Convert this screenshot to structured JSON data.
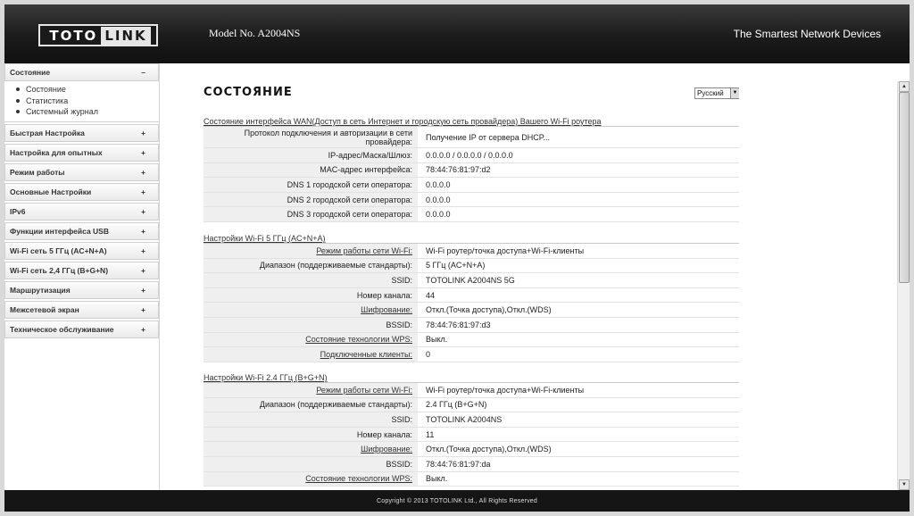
{
  "header": {
    "logo_left": "TOTO",
    "logo_right": "LINK",
    "model": "Model No. A2004NS",
    "tagline": "The Smartest Network Devices"
  },
  "sidebar": {
    "open_item": {
      "label": "Состояние",
      "toggle": "–"
    },
    "submenu": [
      "Состояние",
      "Статистика",
      "Системный журнал"
    ],
    "items": [
      {
        "label": "Быстрая Настройка",
        "toggle": "+"
      },
      {
        "label": "Настройка для опытных",
        "toggle": "+"
      },
      {
        "label": "Режим работы",
        "toggle": "+"
      },
      {
        "label": "Основные Настройки",
        "toggle": "+"
      },
      {
        "label": "IPv6",
        "toggle": "+"
      },
      {
        "label": "Функции интерфейса USB",
        "toggle": "+"
      },
      {
        "label": "Wi-Fi сеть 5 ГГц (AC+N+A)",
        "toggle": "+"
      },
      {
        "label": "Wi-Fi сеть 2,4 ГГц (B+G+N)",
        "toggle": "+"
      },
      {
        "label": "Маршрутизация",
        "toggle": "+"
      },
      {
        "label": "Межсетевой экран",
        "toggle": "+"
      },
      {
        "label": "Техническое обслуживание",
        "toggle": "+"
      }
    ]
  },
  "main": {
    "title": "СОСТОЯНИЕ",
    "language": "Русский",
    "wan": {
      "title": "Состояние интерфейса WAN(Доступ в сеть Интернет и городскую сеть провайдера) Вашего Wi-Fi роутера",
      "rows": [
        {
          "label": "Протокол подключения и авторизации в сети провайдера:",
          "value": "Получение IP от сервера DHCP..."
        },
        {
          "label": "IP-адрес/Маска/Шлюз:",
          "value": "0.0.0.0 / 0.0.0.0 / 0.0.0.0"
        },
        {
          "label": "MAC-адрес интерфейса:",
          "value": "78:44:76:81:97:d2"
        },
        {
          "label": "DNS 1 городской сети оператора:",
          "value": "0.0.0.0"
        },
        {
          "label": "DNS 2 городской сети оператора:",
          "value": "0.0.0.0"
        },
        {
          "label": "DNS 3 городской сети оператора:",
          "value": "0.0.0.0"
        }
      ]
    },
    "wifi5": {
      "title": "Настройки Wi-Fi 5 ГГц (AC+N+A)",
      "rows": [
        {
          "label": "Режим работы сети Wi-Fi:",
          "value": "Wi-Fi роутер/точка доступа+Wi-Fi-клиенты"
        },
        {
          "label": "Диапазон (поддерживаемые стандарты):",
          "value": "5 ГГц (AC+N+A)"
        },
        {
          "label": "SSID:",
          "value": "TOTOLINK A2004NS 5G"
        },
        {
          "label": "Номер канала:",
          "value": "44"
        },
        {
          "label": "Шифрование:",
          "value": "Откл.(Точка доступа),Откл.(WDS)"
        },
        {
          "label": "BSSID:",
          "value": "78:44:76:81:97:d3"
        },
        {
          "label": "Состояние технологии WPS:",
          "value": "Выкл."
        },
        {
          "label": "Подключенные клиенты:",
          "value": "0"
        }
      ]
    },
    "wifi24": {
      "title": "Настройки Wi-Fi 2.4 ГГц (B+G+N)",
      "rows": [
        {
          "label": "Режим работы сети Wi-Fi:",
          "value": "Wi-Fi роутер/точка доступа+Wi-Fi-клиенты"
        },
        {
          "label": "Диапазон (поддерживаемые стандарты):",
          "value": "2.4 ГГц (B+G+N)"
        },
        {
          "label": "SSID:",
          "value": "TOTOLINK A2004NS"
        },
        {
          "label": "Номер канала:",
          "value": "11"
        },
        {
          "label": "Шифрование:",
          "value": "Откл.(Точка доступа),Откл.(WDS)"
        },
        {
          "label": "BSSID:",
          "value": "78:44:76:81:97:da"
        },
        {
          "label": "Состояние технологии WPS:",
          "value": "Выкл."
        }
      ]
    }
  },
  "footer": {
    "copyright": "Copyright © 2013 TOTOLINK Ltd.,   All Rights Reserved"
  }
}
